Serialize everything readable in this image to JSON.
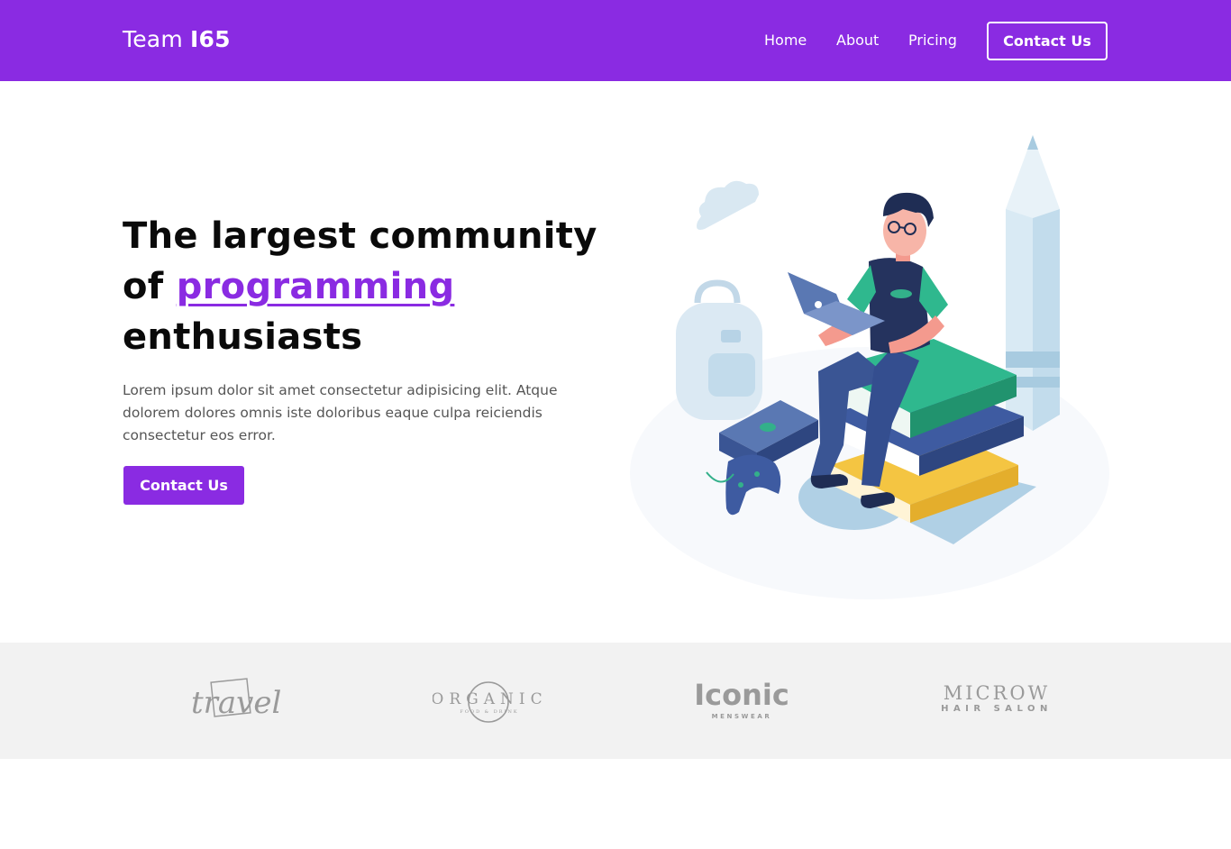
{
  "header": {
    "brand_prefix": "Team",
    "brand_suffix": "I65",
    "nav": [
      "Home",
      "About",
      "Pricing"
    ],
    "cta_label": "Contact Us",
    "background_color": "#8a2be2"
  },
  "hero": {
    "title_line1": "The largest community",
    "title_of": "of",
    "title_highlight": "programming",
    "title_line3": "enthusiasts",
    "description": "Lorem ipsum dolor sit amet consectetur adipisicing elit. Atque dolorem dolores omnis iste doloribus eaque culpa reiciendis consectetur eos error.",
    "cta_label": "Contact Us",
    "accent_color": "#8a2be2",
    "illustration_icon": "developer-on-books-illustration"
  },
  "logos": {
    "travel": {
      "name": "travel"
    },
    "organic": {
      "name": "ORGANIC",
      "tagline": "FOOD & DRINK"
    },
    "iconic": {
      "name": "Iconic",
      "tagline": "MENSWEAR"
    },
    "microw": {
      "name": "MICROW",
      "tagline": "HAIR SALON"
    }
  }
}
